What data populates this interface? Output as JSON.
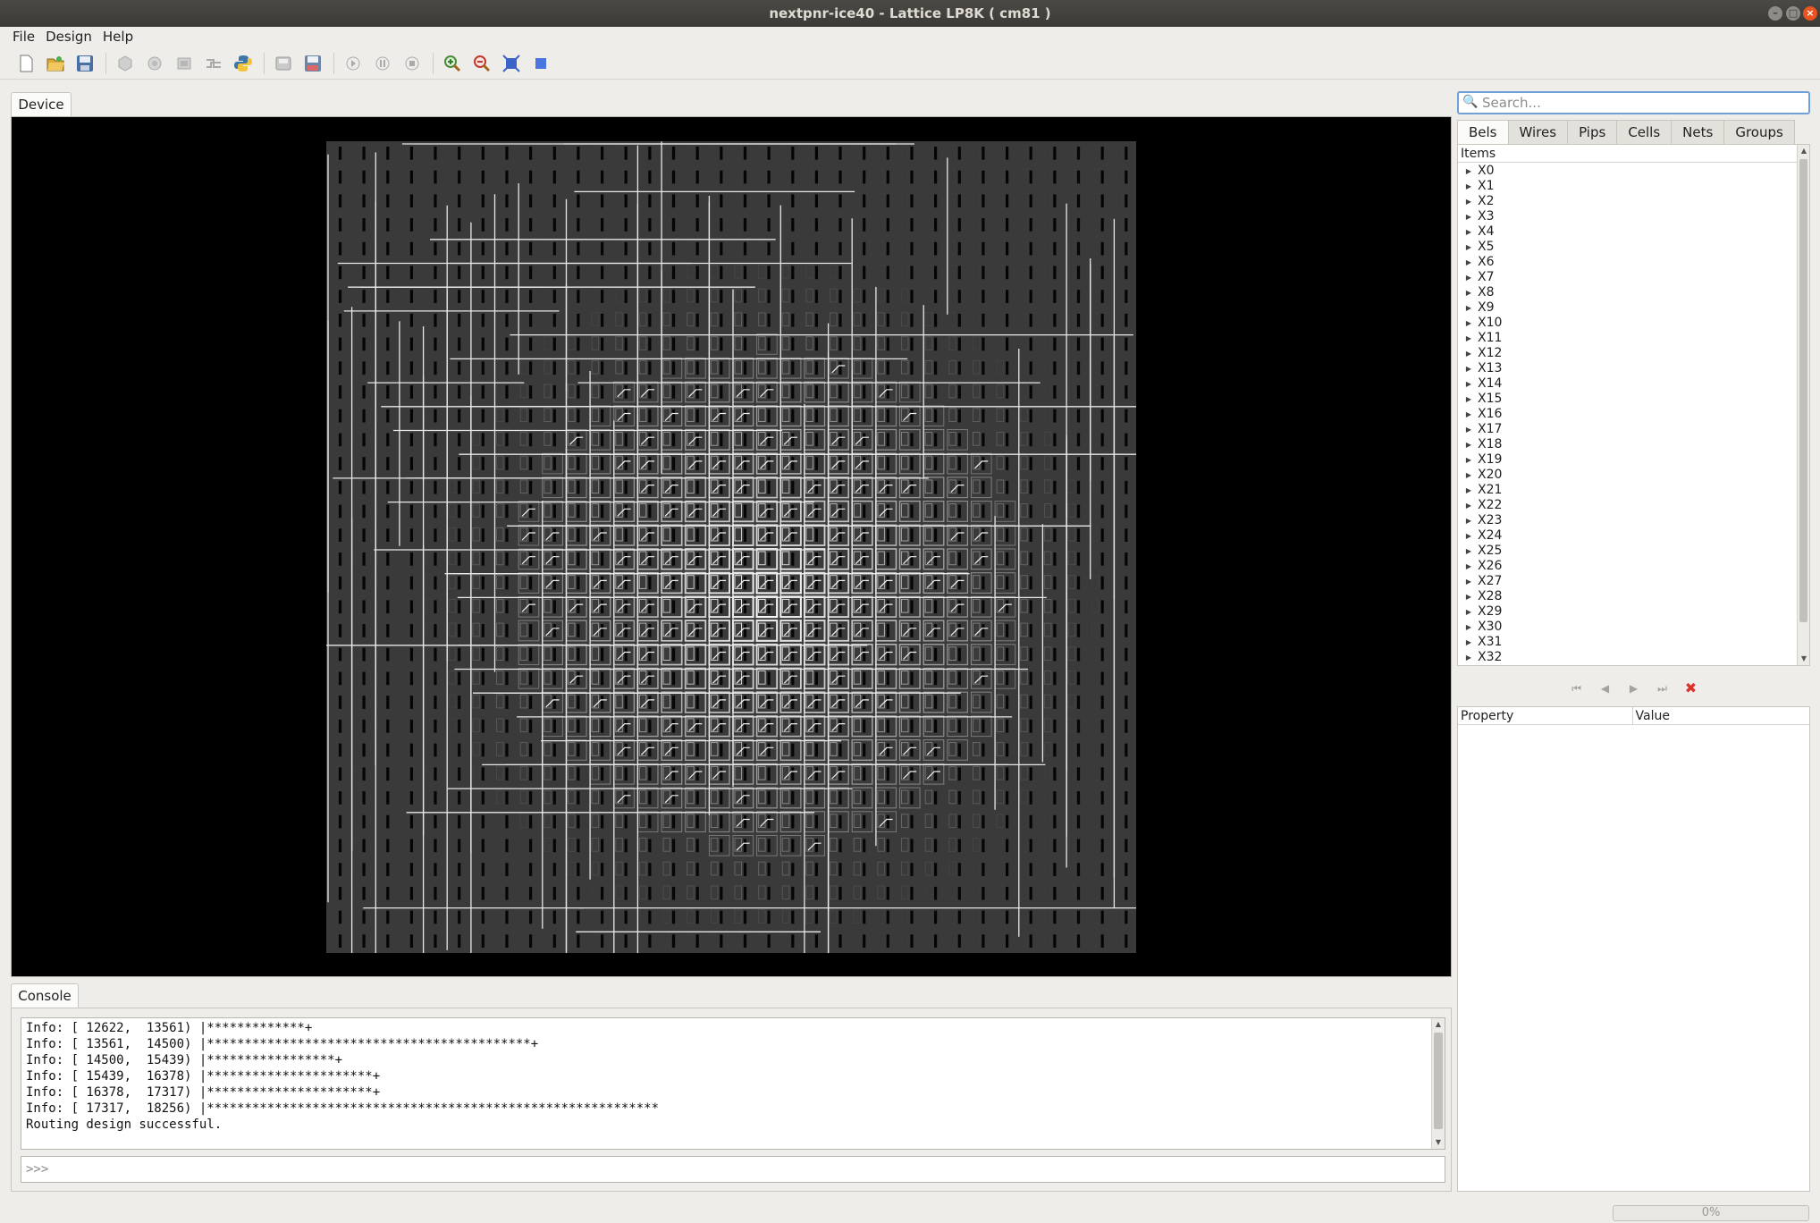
{
  "window": {
    "title": "nextpnr-ice40 - Lattice LP8K ( cm81 )"
  },
  "menu": {
    "items": [
      "File",
      "Design",
      "Help"
    ]
  },
  "toolbar": {
    "buttons": [
      "new-file-icon",
      "open-file-icon",
      "save-file-icon",
      "pack-icon",
      "assign-budget-icon",
      "place-icon",
      "route-icon",
      "python-script-icon",
      "save-asc-icon",
      "save-json-icon",
      "play-icon",
      "pause-icon",
      "stop-icon",
      "zoom-in-icon",
      "zoom-out-icon",
      "zoom-fit-icon",
      "zoom-selected-icon"
    ]
  },
  "device_tab": {
    "label": "Device"
  },
  "console": {
    "tab_label": "Console",
    "lines": [
      "Info: [ 12622,  13561) |*************+",
      "Info: [ 13561,  14500) |*******************************************+",
      "Info: [ 14500,  15439) |*****************+",
      "Info: [ 15439,  16378) |**********************+",
      "Info: [ 16378,  17317) |**********************+",
      "Info: [ 17317,  18256) |************************************************************",
      "Routing design successful."
    ],
    "prompt": ">>>"
  },
  "search": {
    "placeholder": "Search..."
  },
  "tabs": [
    "Bels",
    "Wires",
    "Pips",
    "Cells",
    "Nets",
    "Groups"
  ],
  "active_tab": "Bels",
  "tree": {
    "header": "Items",
    "items": [
      "X0",
      "X1",
      "X2",
      "X3",
      "X4",
      "X5",
      "X6",
      "X7",
      "X8",
      "X9",
      "X10",
      "X11",
      "X12",
      "X13",
      "X14",
      "X15",
      "X16",
      "X17",
      "X18",
      "X19",
      "X20",
      "X21",
      "X22",
      "X23",
      "X24",
      "X25",
      "X26",
      "X27",
      "X28",
      "X29",
      "X30",
      "X31",
      "X32"
    ]
  },
  "property_table": {
    "headers": [
      "Property",
      "Value"
    ]
  },
  "status": {
    "progress": "0%"
  },
  "colors": {
    "accent": "#e95420",
    "focus": "#6fa1d8",
    "canvas": "#000000"
  }
}
